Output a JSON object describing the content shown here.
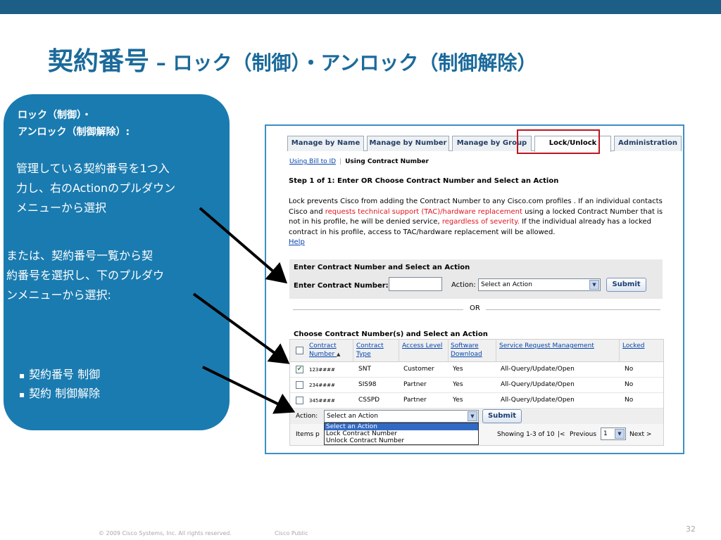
{
  "slide": {
    "title_main": "契約番号",
    "title_dash": " – ",
    "title_sub": "ロック（制御）・アンロック（制御解除）",
    "footer_copyright": "© 2009 Cisco Systems, Inc. All rights reserved.",
    "footer_class": "Cisco Public",
    "page_number": "32"
  },
  "callout": {
    "heading_line1": "ロック（制御）・",
    "heading_line2": "アンロック（制御解除）:",
    "para1_line1": "管理している契約番号を1つ入",
    "para1_line2": "力し、右のActionのプルダウン",
    "para1_line3": "メニューから選択",
    "para2_line1": "または、契約番号一覧から契",
    "para2_line2": "約番号を選択し、下のプルダウ",
    "para2_line3": "ンメニューから選択:",
    "list": [
      "契約番号 制御",
      "契約 制御解除"
    ]
  },
  "screenshot": {
    "tabs": [
      "Manage by Name",
      "Manage by Number",
      "Manage by Group",
      "Lock/Unlock",
      "Administration"
    ],
    "breadcrumb_link": "Using Bill to ID",
    "breadcrumb_current": "Using Contract Number",
    "step": "Step 1 of 1: Enter OR Choose Contract Number and Select an Action",
    "desc_1": "Lock prevents Cisco from adding the Contract Number to any Cisco.com profiles . If an individual contacts Cisco and ",
    "desc_red1": "requests technical support (TAC)/hardware replacement",
    "desc_2": " using a locked Contract Number that is not in his profile, he will be denied service, ",
    "desc_red2": "regardless of severity.",
    "desc_3": " If the individual already has a locked contract in his profile, access to TAC/hardware replacement will be allowed.",
    "help_link": "Help",
    "enter_title": "Enter Contract Number and Select an Action",
    "enter_label": "Enter Contract Number:",
    "action_label": "Action:",
    "action_select_value": "Select an Action",
    "submit_label": "Submit",
    "or_text": "OR",
    "choose_title": "Choose Contract Number(s) and Select an Action",
    "grid_headers": {
      "contract_number_1": "Contract",
      "contract_number_2": "Number",
      "contract_type_1": "Contract",
      "contract_type_2": "Type",
      "access_level": "Access Level",
      "software_download_1": "Software",
      "software_download_2": "Download",
      "service_request": "Service Request Management",
      "locked": "Locked"
    },
    "rows": [
      {
        "checked": "✔",
        "number": "123####",
        "type": "SNT",
        "access": "Customer",
        "download": "Yes",
        "srm": "All-Query/Update/Open",
        "locked": "No"
      },
      {
        "checked": "",
        "number": "234####",
        "type": "SIS98",
        "access": "Partner",
        "download": "Yes",
        "srm": "All-Query/Update/Open",
        "locked": "No"
      },
      {
        "checked": "",
        "number": "345####",
        "type": "CSSPD",
        "access": "Partner",
        "download": "Yes",
        "srm": "All-Query/Update/Open",
        "locked": "No"
      }
    ],
    "grid_action_label": "Action:",
    "grid_action_value": "Select an Action",
    "grid_submit": "Submit",
    "dropdown_options": [
      "Select an Action",
      "Lock Contract Number",
      "Unlock Contract Number"
    ],
    "items_label": "Items p",
    "showing": "Showing 1-3 of 10",
    "pager_sep": "|<",
    "prev": "Previous",
    "page_value": "1",
    "next": "Next >"
  },
  "colors": {
    "brand_blue": "#1b6a9b",
    "callout_bg": "#1a7bb0",
    "highlight_red": "#c0141e"
  }
}
